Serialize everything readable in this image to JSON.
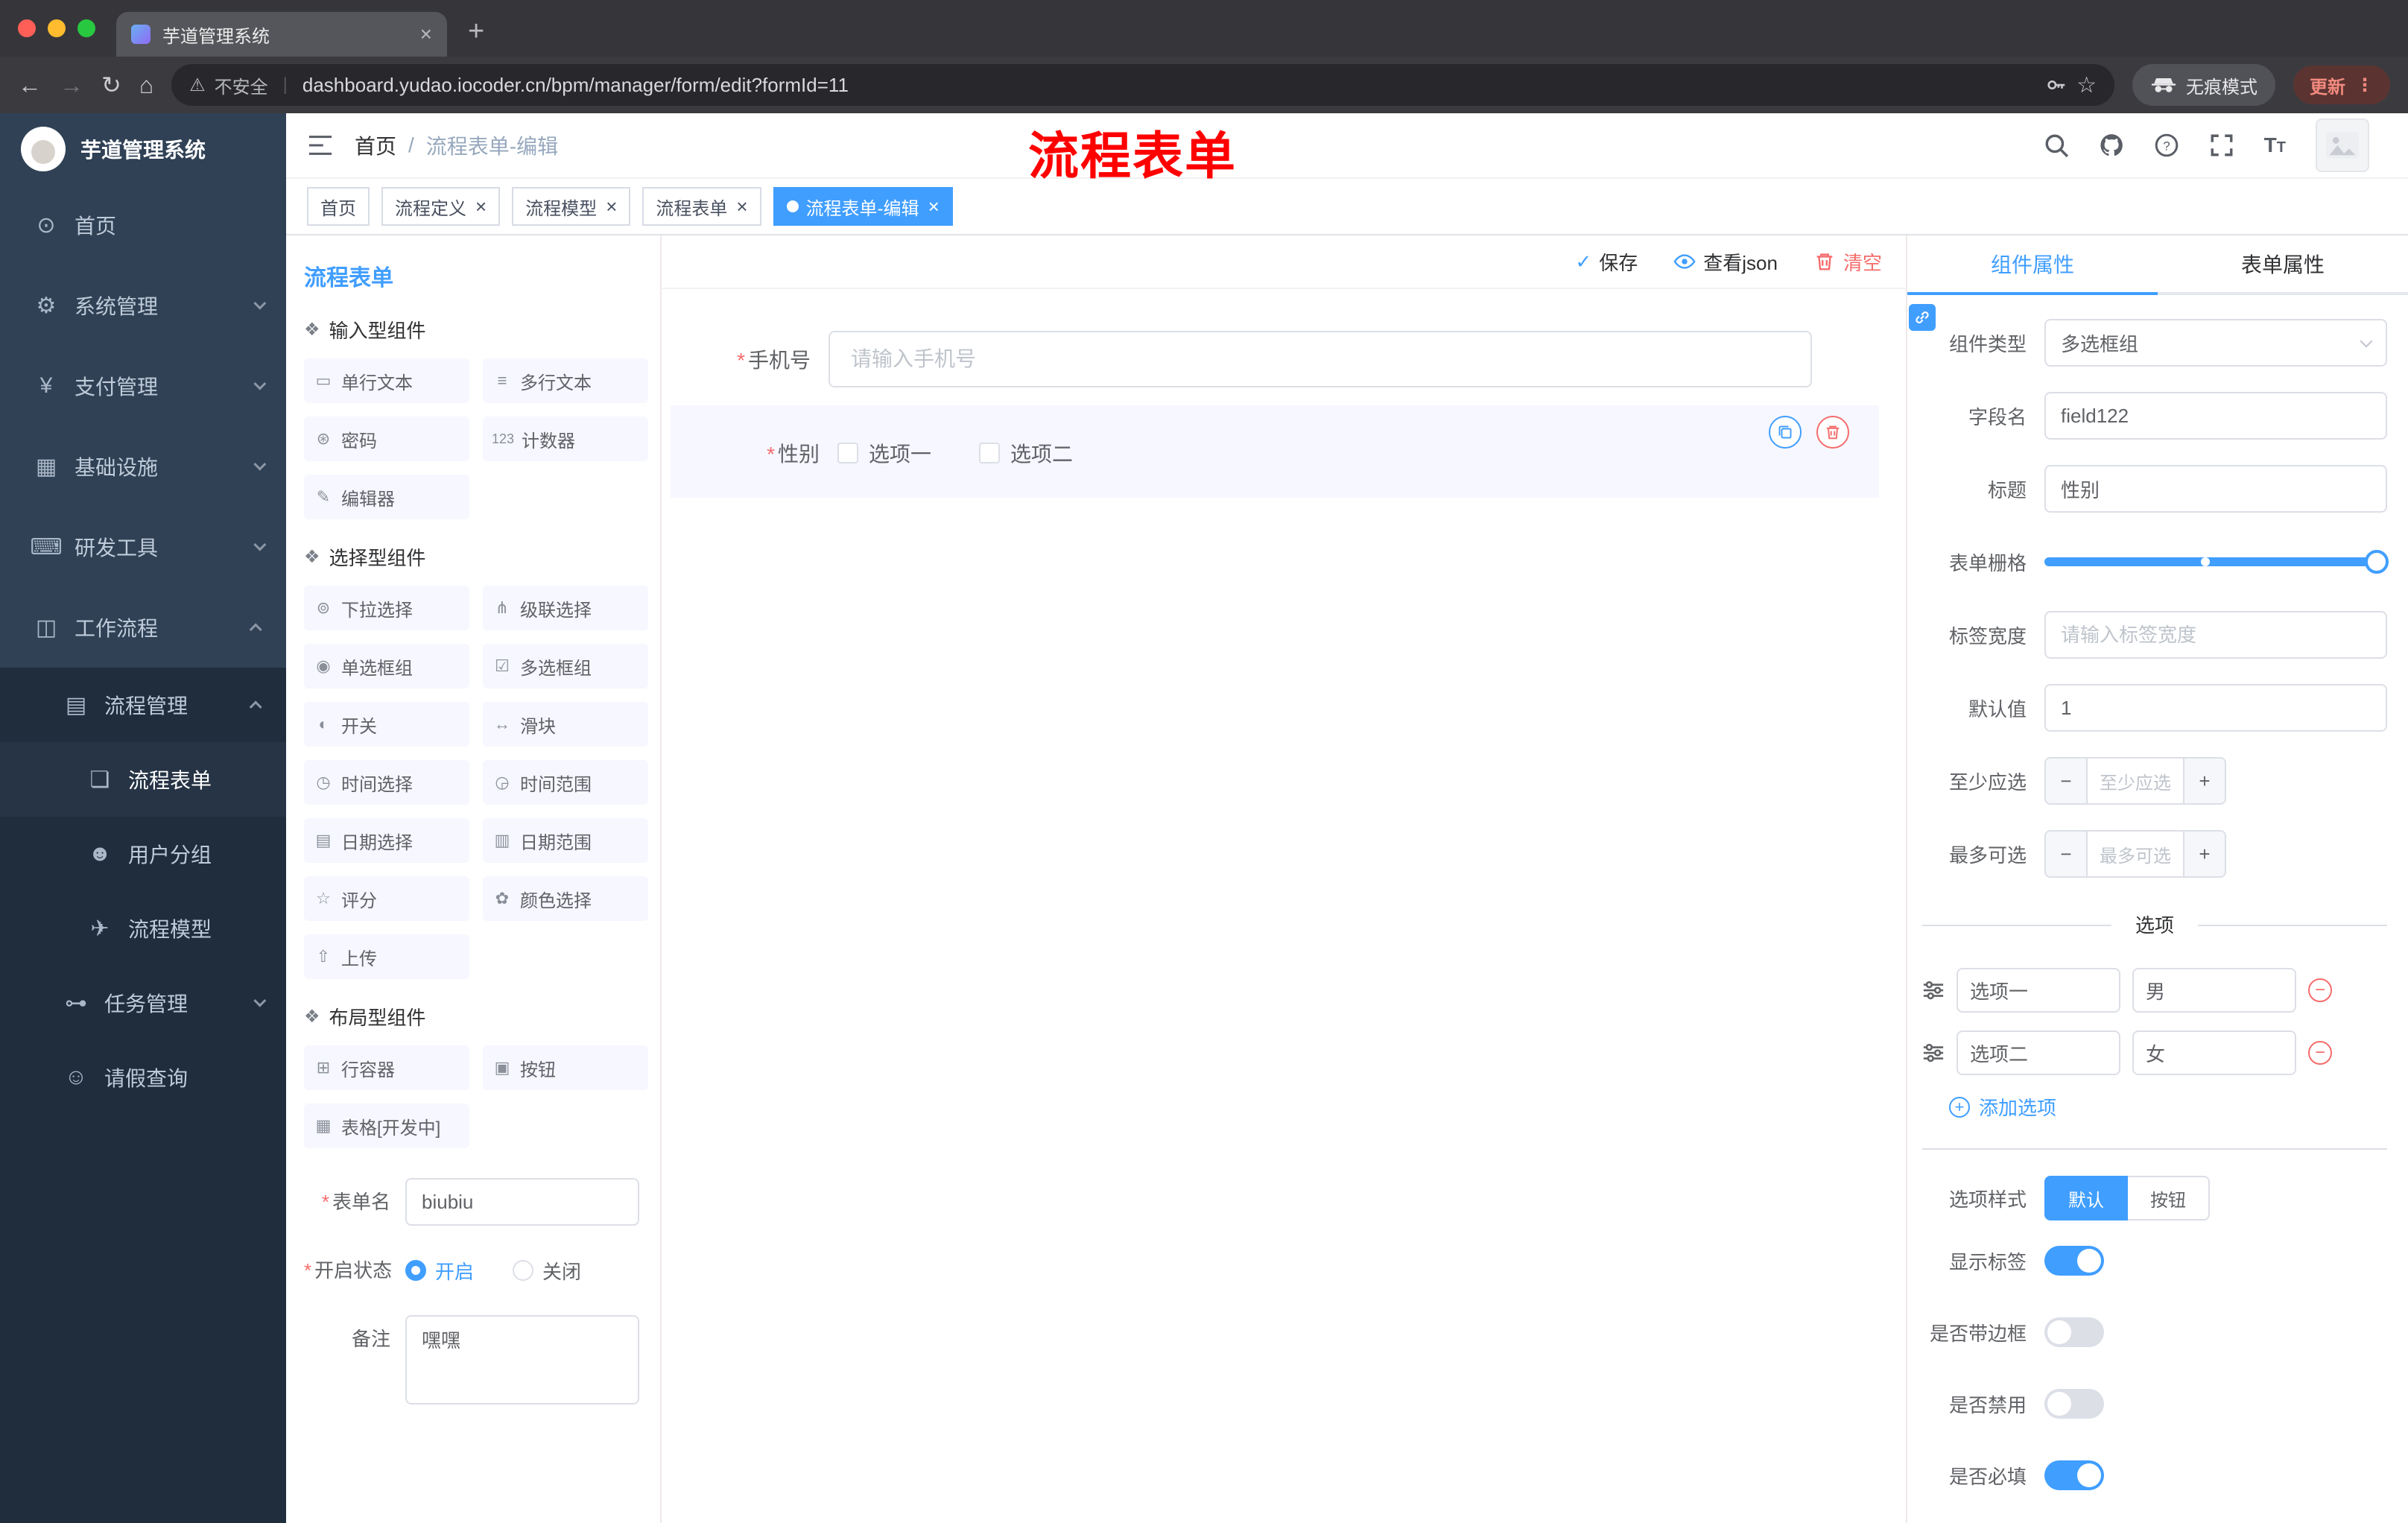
{
  "glyphs": {
    "close": "×",
    "plus": "+",
    "minus": "−",
    "dots": "⋮",
    "check": "✓",
    "star": "☆",
    "warning": "⚠",
    "back": "←",
    "forward": "→",
    "reload": "↻",
    "home": "⌂",
    "asterisk": "*",
    "pipe": "|"
  },
  "colors": {
    "accent": "#409eff",
    "danger": "#f56c6c",
    "annotation_red": "#fe0000",
    "sidebar_bg": "#304156",
    "submenu_bg": "#1f2d3d"
  },
  "browser": {
    "tab_title": "芋道管理系统",
    "security_label": "不安全",
    "url": "dashboard.yudao.iocoder.cn/bpm/manager/form/edit?formId=11",
    "incognito_label": "无痕模式",
    "update_label": "更新"
  },
  "sidebar": {
    "logo_title": "芋道管理系统",
    "items": [
      {
        "label": "首页",
        "icon": "⊙"
      },
      {
        "label": "系统管理",
        "icon": "⚙"
      },
      {
        "label": "支付管理",
        "icon": "¥"
      },
      {
        "label": "基础设施",
        "icon": "▦"
      },
      {
        "label": "研发工具",
        "icon": "⌨"
      },
      {
        "label": "工作流程",
        "icon": "◫"
      }
    ],
    "process_mgmt": {
      "label": "流程管理",
      "icon": "▤"
    },
    "process_children": [
      {
        "label": "流程表单",
        "icon": "❏"
      },
      {
        "label": "用户分组",
        "icon": "☻"
      },
      {
        "label": "流程模型",
        "icon": "✈"
      }
    ],
    "task_mgmt": {
      "label": "任务管理",
      "icon": "⊶"
    },
    "leave_query": {
      "label": "请假查询",
      "icon": "☺"
    }
  },
  "header": {
    "breadcrumb_home": "首页",
    "breadcrumb_sep": "/",
    "breadcrumb_current": "流程表单-编辑",
    "annotation": "流程表单"
  },
  "tags": [
    {
      "label": "首页"
    },
    {
      "label": "流程定义"
    },
    {
      "label": "流程模型"
    },
    {
      "label": "流程表单"
    },
    {
      "label": "流程表单-编辑"
    }
  ],
  "designer": {
    "panel_title": "流程表单",
    "sections": [
      {
        "title": "输入型组件",
        "items": [
          {
            "label": "单行文本",
            "icon": "▭"
          },
          {
            "label": "多行文本",
            "icon": "≡"
          },
          {
            "label": "密码",
            "icon": "⊛"
          },
          {
            "label": "计数器",
            "icon": "123"
          },
          {
            "label": "编辑器",
            "icon": "✎"
          }
        ]
      },
      {
        "title": "选择型组件",
        "items": [
          {
            "label": "下拉选择",
            "icon": "⊚"
          },
          {
            "label": "级联选择",
            "icon": "⋔"
          },
          {
            "label": "单选框组",
            "icon": "◉"
          },
          {
            "label": "多选框组",
            "icon": "☑"
          },
          {
            "label": "开关",
            "icon": "◐"
          },
          {
            "label": "滑块",
            "icon": "↔"
          },
          {
            "label": "时间选择",
            "icon": "◷"
          },
          {
            "label": "时间范围",
            "icon": "◶"
          },
          {
            "label": "日期选择",
            "icon": "▤"
          },
          {
            "label": "日期范围",
            "icon": "▥"
          },
          {
            "label": "评分",
            "icon": "☆"
          },
          {
            "label": "颜色选择",
            "icon": "✿"
          },
          {
            "label": "上传",
            "icon": "⇧"
          }
        ]
      },
      {
        "title": "布局型组件",
        "items": [
          {
            "label": "行容器",
            "icon": "⊞"
          },
          {
            "label": "按钮",
            "icon": "▣"
          },
          {
            "label": "表格[开发中]",
            "icon": "▦"
          }
        ]
      }
    ],
    "meta": {
      "form_name_label": "表单名",
      "form_name_value": "biubiu",
      "status_label": "开启状态",
      "status_on": "开启",
      "status_off": "关闭",
      "remark_label": "备注",
      "remark_value": "嘿嘿"
    }
  },
  "canvas": {
    "toolbar": {
      "save": "保存",
      "view_json": "查看json",
      "clear": "清空"
    },
    "phone": {
      "label": "手机号",
      "placeholder": "请输入手机号"
    },
    "gender": {
      "label": "性别",
      "option1": "选项一",
      "option2": "选项二"
    }
  },
  "props": {
    "tab_component": "组件属性",
    "tab_form": "表单属性",
    "component_type_label": "组件类型",
    "component_type_value": "多选框组",
    "field_name_label": "字段名",
    "field_name_value": "field122",
    "title_label": "标题",
    "title_value": "性别",
    "grid_label": "表单栅格",
    "label_width_label": "标签宽度",
    "label_width_placeholder": "请输入标签宽度",
    "default_label": "默认值",
    "default_value": "1",
    "min_label": "至少应选",
    "min_placeholder": "至少应选",
    "max_label": "最多可选",
    "max_placeholder": "最多可选",
    "options_title": "选项",
    "options": [
      {
        "label": "选项一",
        "value": "男"
      },
      {
        "label": "选项二",
        "value": "女"
      }
    ],
    "add_option": "添加选项",
    "style_label": "选项样式",
    "style_default": "默认",
    "style_button": "按钮",
    "show_label_label": "显示标签",
    "border_label": "是否带边框",
    "disabled_label": "是否禁用",
    "required_label": "是否必填"
  }
}
